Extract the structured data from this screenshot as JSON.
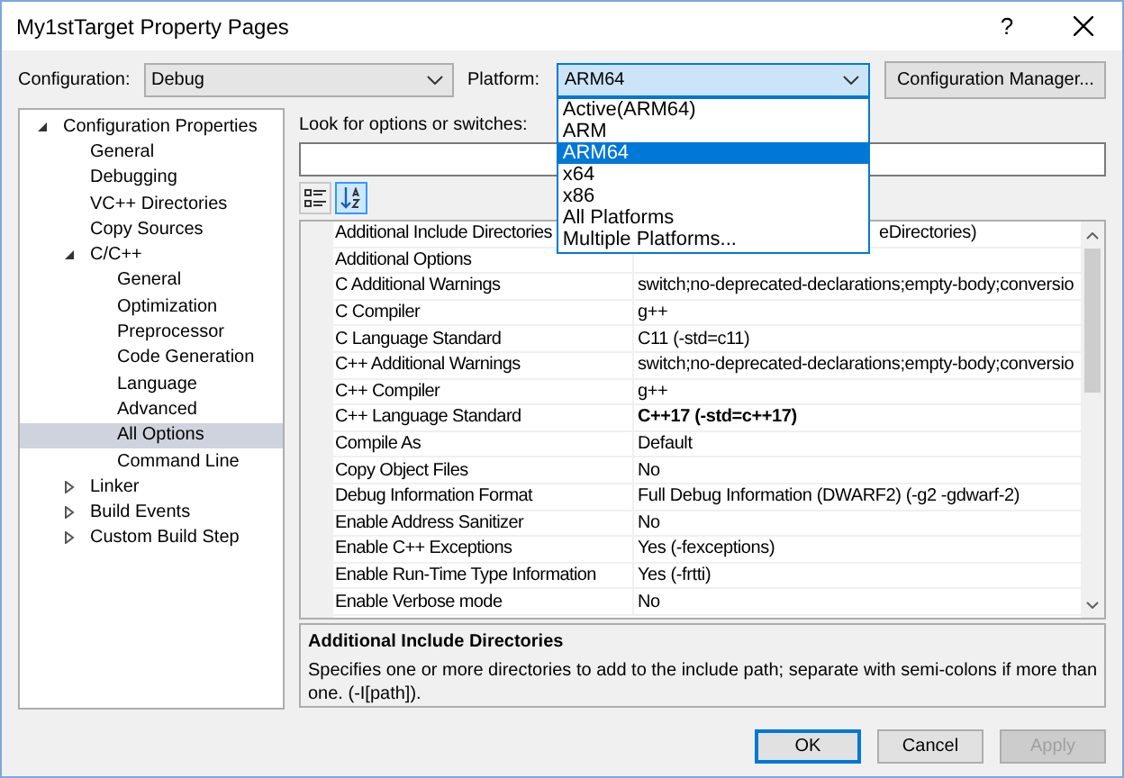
{
  "window": {
    "title": "My1stTarget Property Pages",
    "help_label": "?"
  },
  "configuration": {
    "label": "Configuration:",
    "value": "Debug"
  },
  "platform": {
    "label": "Platform:",
    "value": "ARM64",
    "expanded": true,
    "options": [
      {
        "label": "Active(ARM64)",
        "selected": false
      },
      {
        "label": "ARM",
        "selected": false
      },
      {
        "label": "ARM64",
        "selected": true
      },
      {
        "label": "x64",
        "selected": false
      },
      {
        "label": "x86",
        "selected": false
      },
      {
        "label": "All Platforms",
        "selected": false
      },
      {
        "label": "Multiple Platforms...",
        "selected": false
      }
    ]
  },
  "configuration_manager_button": "Configuration Manager...",
  "tree": [
    {
      "label": "Configuration Properties",
      "expanded": true,
      "selected": false,
      "children": [
        {
          "label": "General",
          "selected": false
        },
        {
          "label": "Debugging",
          "selected": false
        },
        {
          "label": "VC++ Directories",
          "selected": false
        },
        {
          "label": "Copy Sources",
          "selected": false
        },
        {
          "label": "C/C++",
          "expanded": true,
          "selected": false,
          "children": [
            {
              "label": "General",
              "selected": false
            },
            {
              "label": "Optimization",
              "selected": false
            },
            {
              "label": "Preprocessor",
              "selected": false
            },
            {
              "label": "Code Generation",
              "selected": false
            },
            {
              "label": "Language",
              "selected": false
            },
            {
              "label": "Advanced",
              "selected": false
            },
            {
              "label": "All Options",
              "selected": true
            },
            {
              "label": "Command Line",
              "selected": false
            }
          ]
        },
        {
          "label": "Linker",
          "expanded": false,
          "selected": false
        },
        {
          "label": "Build Events",
          "expanded": false,
          "selected": false
        },
        {
          "label": "Custom Build Step",
          "expanded": false,
          "selected": false
        }
      ]
    }
  ],
  "search": {
    "label": "Look for options or switches:"
  },
  "view_buttons": [
    {
      "kind": "categorized",
      "selected": false
    },
    {
      "kind": "alphabetical",
      "selected": true
    }
  ],
  "properties": [
    {
      "name": "Additional Include Directories",
      "value": "eDirectories)",
      "modified": false
    },
    {
      "name": "Additional Options"
    },
    {
      "name": "C Additional Warnings",
      "value": "switch;no-deprecated-declarations;empty-body;conversio",
      "modified": false
    },
    {
      "name": "C Compiler",
      "value": "g++",
      "modified": false
    },
    {
      "name": "C Language Standard",
      "value": "C11 (-std=c11)",
      "modified": false
    },
    {
      "name": "C++ Additional Warnings",
      "value": "switch;no-deprecated-declarations;empty-body;conversio",
      "modified": false
    },
    {
      "name": "C++ Compiler",
      "value": "g++",
      "modified": false
    },
    {
      "name": "C++ Language Standard",
      "value": "C++17 (-std=c++17)",
      "modified": true
    },
    {
      "name": "Compile As",
      "value": "Default",
      "modified": false
    },
    {
      "name": "Copy Object Files",
      "value": "No",
      "modified": false
    },
    {
      "name": "Debug Information Format",
      "value": "Full Debug Information (DWARF2) (-g2 -gdwarf-2)",
      "modified": false
    },
    {
      "name": "Enable Address Sanitizer",
      "value": "No",
      "modified": false
    },
    {
      "name": "Enable C++ Exceptions",
      "value": "Yes (-fexceptions)",
      "modified": false
    },
    {
      "name": "Enable Run-Time Type Information",
      "value": "Yes (-frtti)",
      "modified": false
    },
    {
      "name": "Enable Verbose mode",
      "value": "No",
      "modified": false
    }
  ],
  "description": {
    "title": "Additional Include Directories",
    "text": "Specifies one or more directories to add to the include path; separate with semi-colons if more than one. (-I[path])."
  },
  "buttons": [
    {
      "label": "OK",
      "kind": "default",
      "disabled": false
    },
    {
      "label": "Cancel",
      "kind": "normal",
      "disabled": false
    },
    {
      "label": "Apply",
      "kind": "normal",
      "disabled": true
    }
  ]
}
